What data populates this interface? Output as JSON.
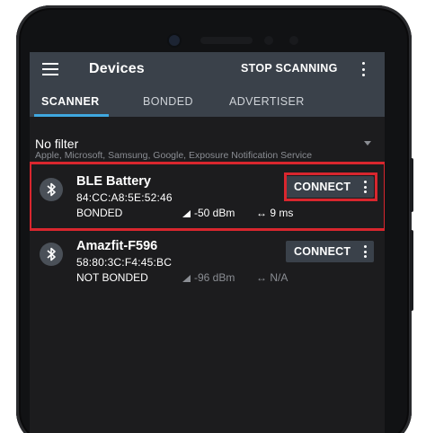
{
  "app": {
    "title": "Devices",
    "stop_scanning_label": "STOP SCANNING"
  },
  "tabs": [
    {
      "label": "SCANNER",
      "active": true
    },
    {
      "label": "BONDED",
      "active": false
    },
    {
      "label": "ADVERTISER",
      "active": false
    }
  ],
  "filter": {
    "title": "No filter",
    "subtitle": "Apple, Microsoft, Samsung, Google, Exposure Notification Service"
  },
  "devices": [
    {
      "name": "BLE Battery",
      "mac": "84:CC:A8:5E:52:46",
      "status": "BONDED",
      "rssi": "-50 dBm",
      "interval": "9 ms",
      "connect_label": "CONNECT",
      "icon": "bluetooth-icon"
    },
    {
      "name": "Amazfit-F596",
      "mac": "58:80:3C:F4:45:BC",
      "status": "NOT BONDED",
      "rssi": "-96 dBm",
      "interval": "N/A",
      "connect_label": "CONNECT",
      "icon": "bluetooth-icon"
    }
  ],
  "colors": {
    "appbar": "#3a414a",
    "tab_indicator": "#3fa8e0",
    "highlight": "#d9262e",
    "screen_bg": "#1c1c1e"
  }
}
